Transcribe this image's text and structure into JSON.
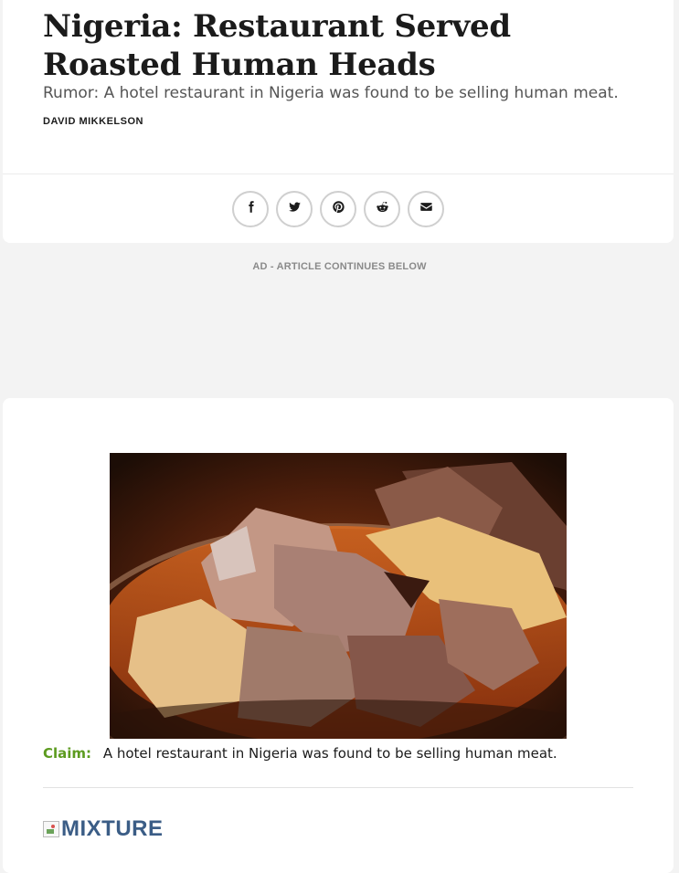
{
  "article": {
    "title": "Nigeria: Restaurant Served Roasted Human Heads",
    "subtitle": "Rumor: A hotel restaurant in Nigeria was found to be selling human meat.",
    "author": "DAVID MIKKELSON"
  },
  "share": {
    "buttons": [
      {
        "icon": "facebook-icon"
      },
      {
        "icon": "twitter-icon"
      },
      {
        "icon": "pinterest-icon"
      },
      {
        "icon": "reddit-icon"
      },
      {
        "icon": "email-icon"
      }
    ]
  },
  "ad": {
    "label": "AD - ARTICLE CONTINUES BELOW"
  },
  "main": {
    "image": {
      "subject": "bowl of meat stew"
    },
    "claim_label": "Claim:",
    "claim_text": "A hotel restaurant in Nigeria was found to be selling human meat.",
    "rating_text": "MIXTURE"
  },
  "colors": {
    "claim_label": "#5c9b1f",
    "rating": "#3b5d86",
    "background": "#f3f3f3"
  }
}
